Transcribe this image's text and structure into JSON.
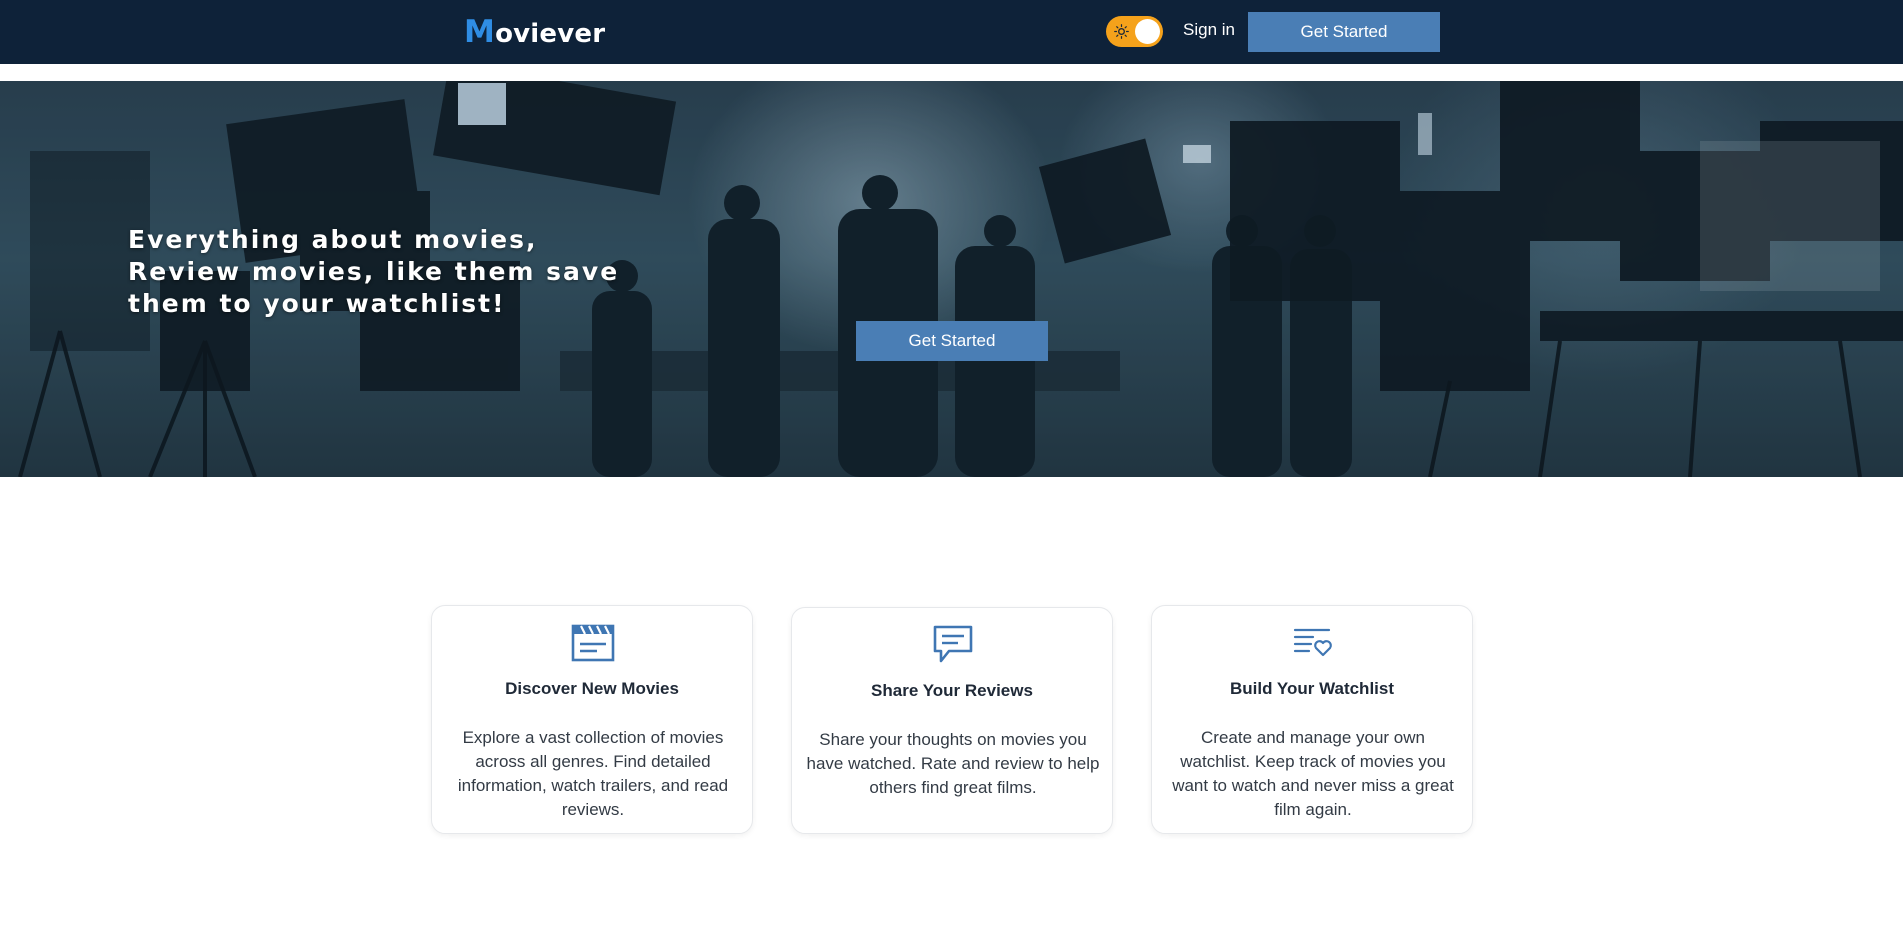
{
  "header": {
    "logo_initial": "M",
    "logo_rest": "oviever",
    "theme_toggle_icon": "sun-icon",
    "signin_label": "Sign in",
    "cta_label": "Get Started"
  },
  "hero": {
    "heading": "Everything about movies, Review movies, like them save them to your watchlist!",
    "cta_label": "Get Started"
  },
  "features": [
    {
      "icon": "clapperboard-icon",
      "title": "Discover New Movies",
      "text": "Explore a vast collection of movies across all genres. Find detailed information, watch trailers, and read reviews."
    },
    {
      "icon": "chat-bubble-icon",
      "title": "Share Your Reviews",
      "text": "Share your thoughts on movies you have watched. Rate and review to help others find great films."
    },
    {
      "icon": "list-heart-icon",
      "title": "Build Your Watchlist",
      "text": "Create and manage your own watchlist. Keep track of movies you want to watch and never miss a great film again."
    }
  ],
  "colors": {
    "navbar": "#0e2239",
    "brand_accent": "#2f8de4",
    "button": "#4a7eb5",
    "toggle": "#f5a21b"
  }
}
